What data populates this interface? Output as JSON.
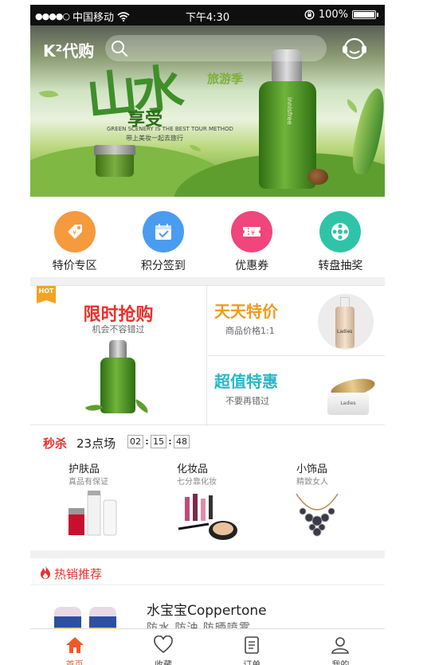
{
  "status_bar": {
    "carrier": "中国移动",
    "time": "下午4:30",
    "battery": "100%"
  },
  "header": {
    "brand": "K²代购",
    "search_placeholder": ""
  },
  "banner": {
    "calligraphy": "山水",
    "tag": "旅游季",
    "title": "享受",
    "subtitle": "GREEN SCENERY IS THE BEST TOUR METHOD",
    "subtitle2": "带上美妆一起去旅行",
    "product": "innisfree"
  },
  "quick_menu": [
    {
      "label": "特价专区",
      "icon": "price-tag-icon",
      "color": "#f59a3d"
    },
    {
      "label": "积分签到",
      "icon": "calendar-check-icon",
      "color": "#4a9cf0"
    },
    {
      "label": "优惠券",
      "icon": "coupon-icon",
      "color": "#f0457d"
    },
    {
      "label": "转盘抽奖",
      "icon": "wheel-icon",
      "color": "#2fc4a8"
    }
  ],
  "promo": {
    "badge": "HOT",
    "flash": {
      "title": "限时抢购",
      "sub": "机会不容错过",
      "color": "#e8312c"
    },
    "daily": {
      "title": "天天特价",
      "sub": "商品价格1:1",
      "color": "#f39a1e"
    },
    "value": {
      "title": "超值特惠",
      "sub": "不要再错过",
      "color": "#27b7c8"
    },
    "product_label": "Ladies"
  },
  "flash_sale": {
    "tag": "秒杀",
    "session": "23点场",
    "countdown": {
      "h": "02",
      "m": "15",
      "s": "48"
    },
    "categories": [
      {
        "name": "护肤品",
        "desc": "真品有保证"
      },
      {
        "name": "化妆品",
        "desc": "七分靠化妆"
      },
      {
        "name": "小饰品",
        "desc": "精致女人"
      }
    ]
  },
  "hot": {
    "title": "热销推荐",
    "items": [
      {
        "title": "水宝宝Coppertone",
        "sub": "防水  防油  防晒喷雾"
      }
    ]
  },
  "tab_bar": [
    {
      "label": "首页",
      "icon": "home-icon",
      "active": true
    },
    {
      "label": "收藏",
      "icon": "heart-icon",
      "active": false
    },
    {
      "label": "订单",
      "icon": "order-icon",
      "active": false
    },
    {
      "label": "我的",
      "icon": "user-icon",
      "active": false
    }
  ],
  "colors": {
    "accent": "#ef5a24",
    "sale_red": "#e8312c",
    "status_bar": "#0f0f0f"
  }
}
